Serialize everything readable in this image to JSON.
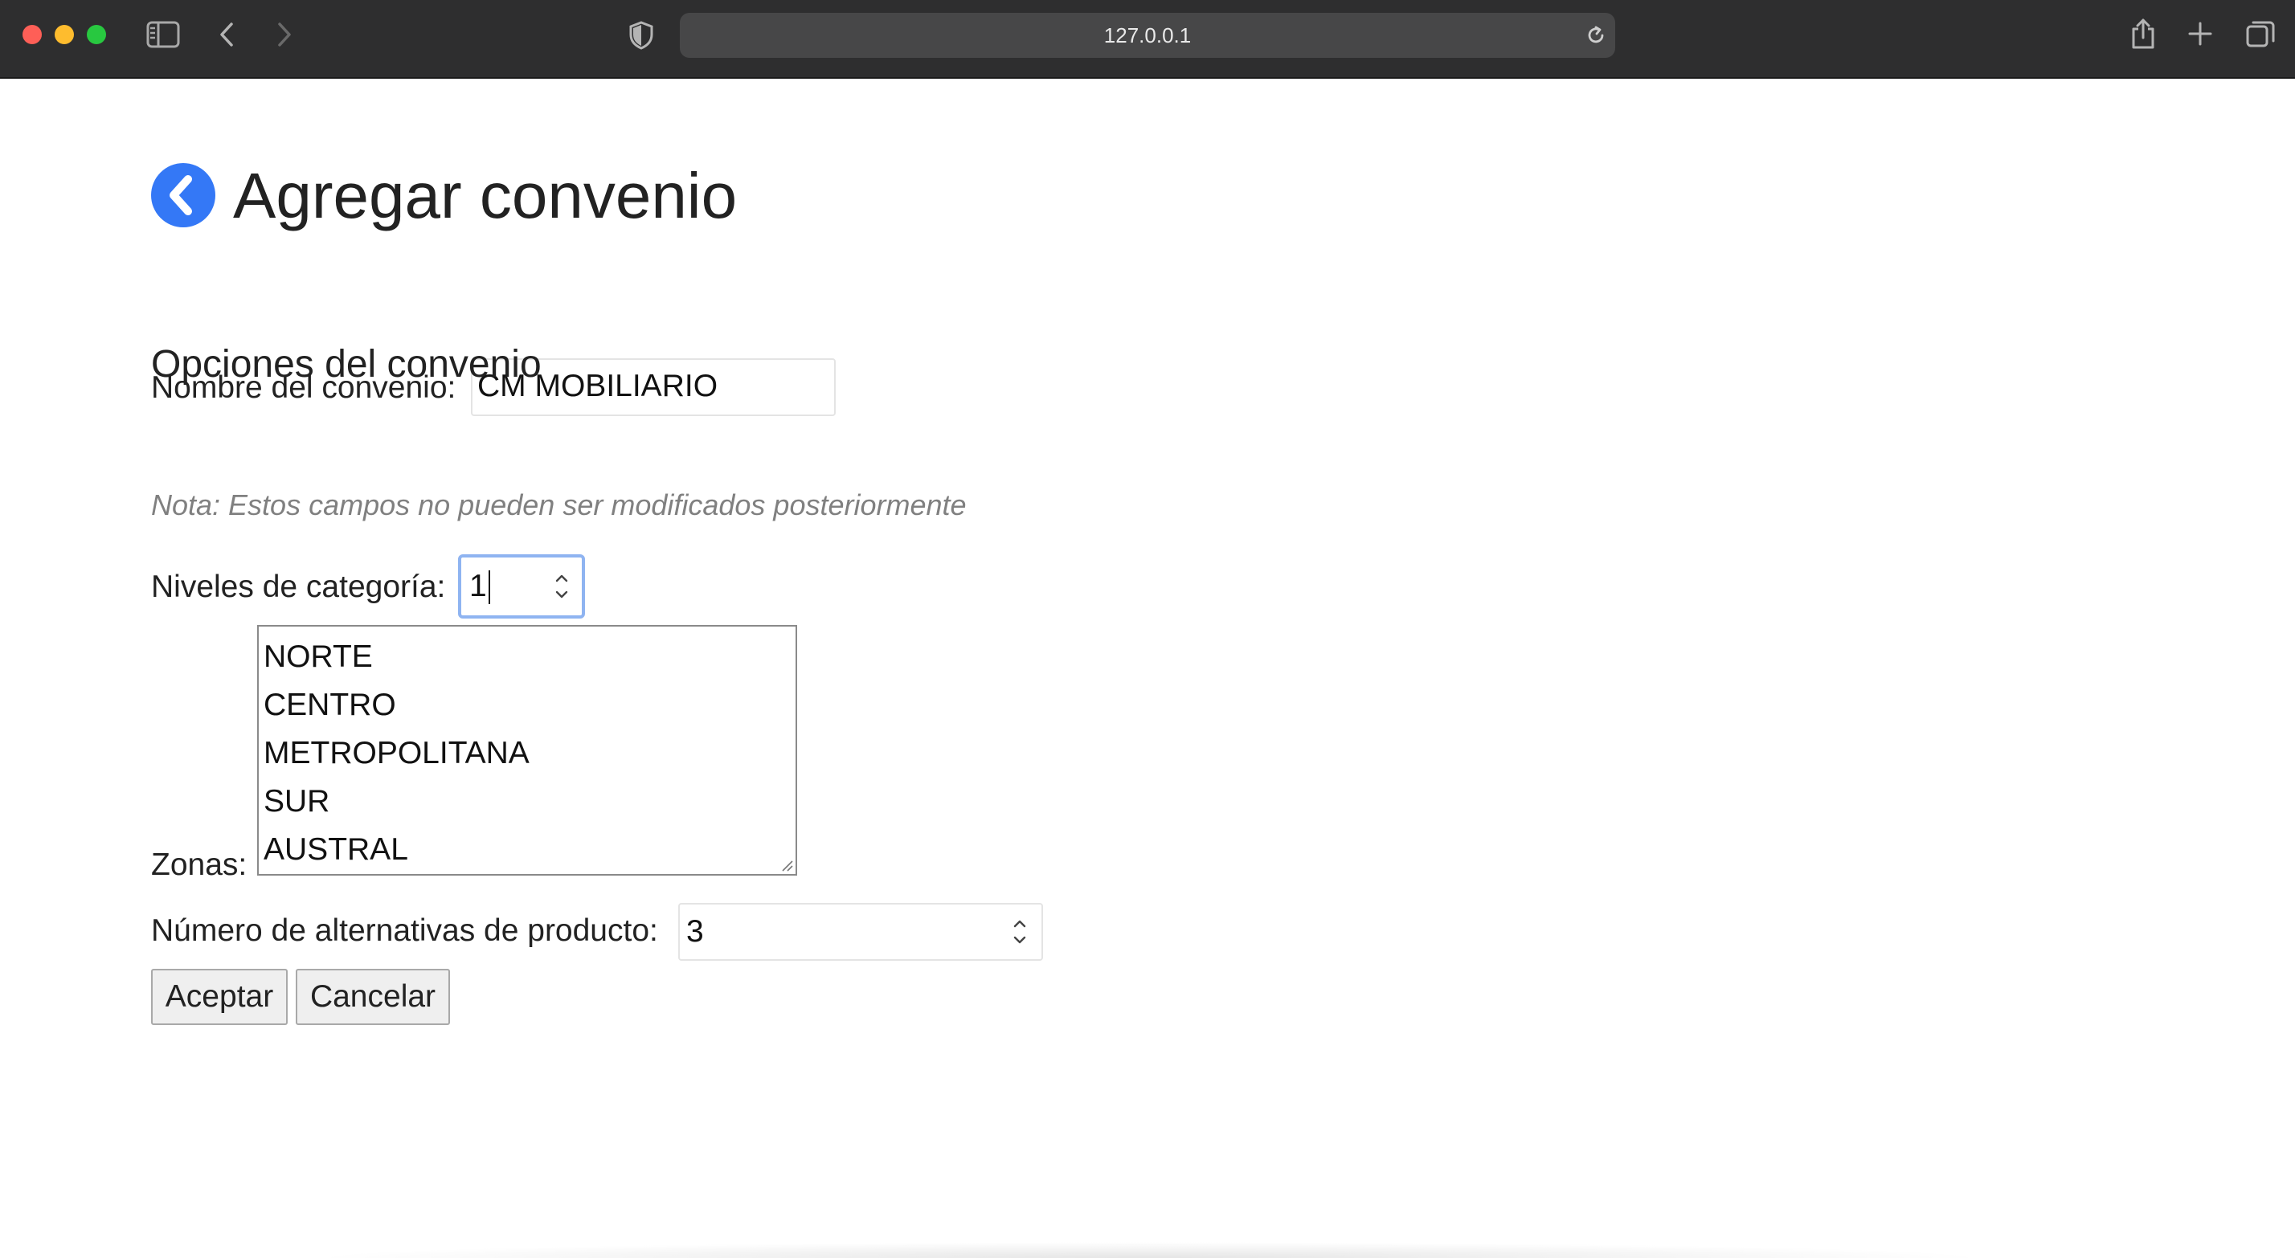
{
  "browser": {
    "url": "127.0.0.1",
    "icons": {
      "sidebar": "sidebar-icon",
      "back": "chevron-left-icon",
      "forward": "chevron-right-icon",
      "privacy": "shield-icon",
      "reload": "reload-icon",
      "share": "share-icon",
      "new_tab": "plus-icon",
      "tabs": "tab-overview-icon"
    }
  },
  "page": {
    "title": "Agregar convenio",
    "back_icon": "chevron-left-circle-icon",
    "accent_color": "#3478f6"
  },
  "form": {
    "name_label": "Nombre del convenio:",
    "name_value": "CM MOBILIARIO",
    "options_title": "Opciones del convenio",
    "note": "Nota: Estos campos no pueden ser modificados posteriormente",
    "levels_label": "Niveles de categoría:",
    "levels_value": "1",
    "zones_label": "Zonas:",
    "zones": [
      "NORTE",
      "CENTRO",
      "METROPOLITANA",
      "SUR",
      "AUSTRAL"
    ],
    "alternatives_label": "Número de alternativas de producto:",
    "alternatives_value": "3",
    "accept_label": "Aceptar",
    "cancel_label": "Cancelar"
  }
}
